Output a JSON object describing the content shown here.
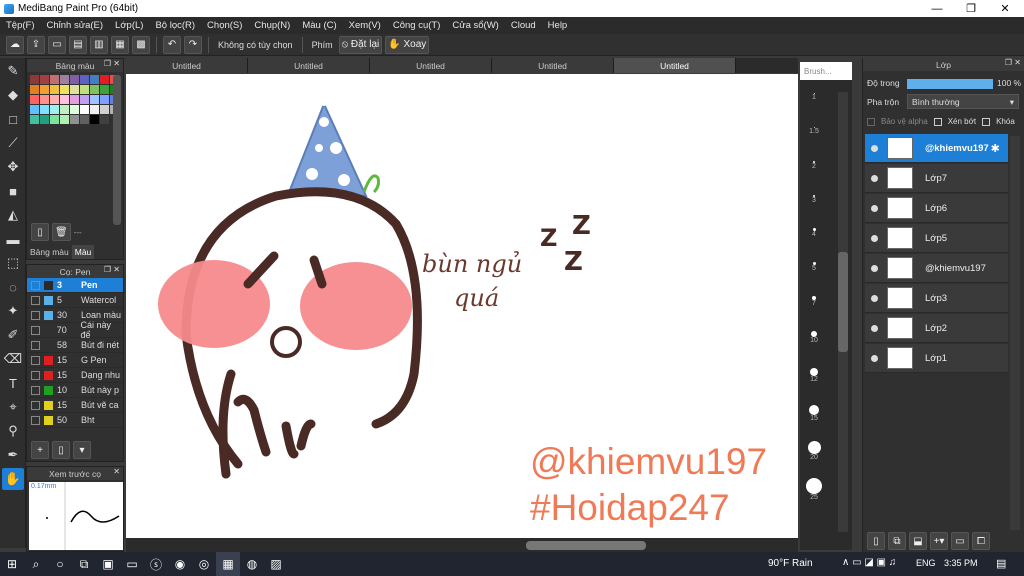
{
  "window": {
    "title": "MediBang Paint Pro (64bit)",
    "minimize": "—",
    "maximize": "❐",
    "close": "✕"
  },
  "menu": [
    "Tệp(F)",
    "Chỉnh sửa(E)",
    "Lớp(L)",
    "Bộ lọc(R)",
    "Chọn(S)",
    "Chụp(N)",
    "Màu (C)",
    "Xem(V)",
    "Công cụ(T)",
    "Cửa sổ(W)",
    "Cloud",
    "Help"
  ],
  "toolbar": {
    "no_option": "Không có tùy chọn",
    "keys_label": "Phím",
    "reset": "Đặt lại",
    "rotate": "Xoay"
  },
  "palette_panel": {
    "title": "Bảng màu",
    "tab_palette": "Bảng màu",
    "tab_color": "Màu",
    "hsv_label": "---"
  },
  "palette_colors": [
    "#8a3a3a",
    "#a04040",
    "#c07070",
    "#a080a0",
    "#8060a0",
    "#6060c0",
    "#4080c0",
    "#e02020",
    "#e05050",
    "#e08020",
    "#f0a030",
    "#f0c040",
    "#f0e060",
    "#e0e0a0",
    "#c0e080",
    "#80c060",
    "#40a040",
    "#208020",
    "#ff6060",
    "#ff9090",
    "#ffb0b0",
    "#ffc0e0",
    "#e0a0e0",
    "#c0a0f0",
    "#a0c0ff",
    "#80a0ff",
    "#6080e0",
    "#60c0ff",
    "#80e0ff",
    "#a0f0f0",
    "#c0f0c0",
    "#e0ffe0",
    "#ffffff",
    "#f0f0f0",
    "#d0d0d0",
    "#b0b0b0",
    "#40c0a0",
    "#20a080",
    "#80e0a0",
    "#b0f0b0",
    "#909090",
    "#606060",
    "#000000",
    "#404040",
    "#303030"
  ],
  "brush_panel": {
    "title": "Cọ: Pen",
    "items": [
      {
        "size": "3",
        "name": "Pen",
        "color": "#2a2a2a",
        "selected": true
      },
      {
        "size": "5",
        "name": "Watercol",
        "color": "#5ab0e8",
        "selected": false
      },
      {
        "size": "30",
        "name": "Loan màu",
        "color": "#5ab0e8",
        "selected": false
      },
      {
        "size": "70",
        "name": "Cái này để",
        "color": "#303030",
        "selected": false
      },
      {
        "size": "58",
        "name": "Bút đi nét",
        "color": "#303030",
        "selected": false
      },
      {
        "size": "15",
        "name": "G Pen",
        "color": "#e02020",
        "selected": false
      },
      {
        "size": "15",
        "name": "Dạng nhu",
        "color": "#e02020",
        "selected": false
      },
      {
        "size": "10",
        "name": "Bút này p",
        "color": "#20a020",
        "selected": false
      },
      {
        "size": "15",
        "name": "Bút vẽ ca",
        "color": "#e0d020",
        "selected": false
      },
      {
        "size": "50",
        "name": "Bht",
        "color": "#e0d020",
        "selected": false
      }
    ]
  },
  "preview_panel": {
    "title": "Xem trước cọ",
    "size_label": "0.17mm"
  },
  "doc_tabs": [
    "Untitled",
    "Untitled",
    "Untitled",
    "Untitled",
    "Untitled"
  ],
  "brush_size_panel": {
    "title": "Brush...",
    "sizes": [
      "1",
      "1.5",
      "2",
      "3",
      "4",
      "5",
      "7",
      "10",
      "12",
      "15",
      "20",
      "25"
    ]
  },
  "layer_panel": {
    "title": "Lớp",
    "opacity_label": "Độ trong",
    "opacity_value": "100 %",
    "opacity": 1.0,
    "blend_label": "Pha trộn",
    "blend_value": "Bình thường",
    "protect_alpha": "Bảo vệ alpha",
    "clipping": "Xén bớt",
    "lock": "Khóa",
    "layers": [
      "@khiemvu197",
      "Lớp7",
      "Lớp6",
      "Lớp5",
      "@khiemvu197",
      "Lớp3",
      "Lớp2",
      "Lớp1"
    ]
  },
  "canvas": {
    "handwriting_line1": "bùn ngủ",
    "handwriting_line2": "quá",
    "zzz": "Z",
    "watermark1": "@khiemvu197",
    "watermark2": "#Hoidap247"
  },
  "taskbar": {
    "weather": "90°F  Rain",
    "lang": "ENG",
    "time": "3:35 PM"
  }
}
